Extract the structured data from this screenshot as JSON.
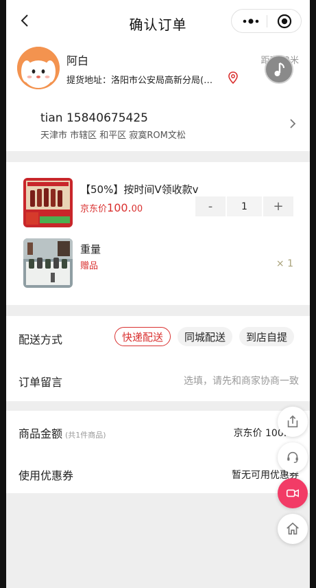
{
  "nav": {
    "title": "确认订单",
    "back_icon": "back-chevron-icon",
    "more_icon": "more-dots-icon",
    "close_icon": "target-close-icon"
  },
  "store": {
    "name": "阿白",
    "distance": "距离12米",
    "pickup_address": "提货地址：洛阳市公安局高新分局(…",
    "pin_icon": "location-pin-icon"
  },
  "address": {
    "recipient": "tian 15840675425",
    "detail": "天津市 市辖区 和平区 寂寞ROM文松"
  },
  "products": [
    {
      "title": "【50%】按时间V领收款v",
      "price_prefix": "京东价",
      "price_int": "100.",
      "price_dec": "00",
      "quantity": "1",
      "minus": "-",
      "plus": "+"
    },
    {
      "title": "重量",
      "tag": "赠品",
      "quantity": "× 1"
    }
  ],
  "shipping": {
    "label": "配送方式",
    "options": [
      "快递配送",
      "同城配送",
      "到店自提"
    ],
    "selected": "快递配送"
  },
  "remark": {
    "label": "订单留言",
    "placeholder": "选填，请先和商家协商一致"
  },
  "amount": {
    "label": "商品金额",
    "sub": "(共1件商品)",
    "value": "京东价 100.00"
  },
  "coupon": {
    "label": "使用优惠券",
    "value": "暂无可用优惠券"
  },
  "floating": [
    "share-icon",
    "customer-service-icon",
    "video-icon",
    "home-icon"
  ],
  "colors": {
    "accent": "#d9302f",
    "fab_red": "#f23b66",
    "page_bg": "#eeeeee"
  }
}
